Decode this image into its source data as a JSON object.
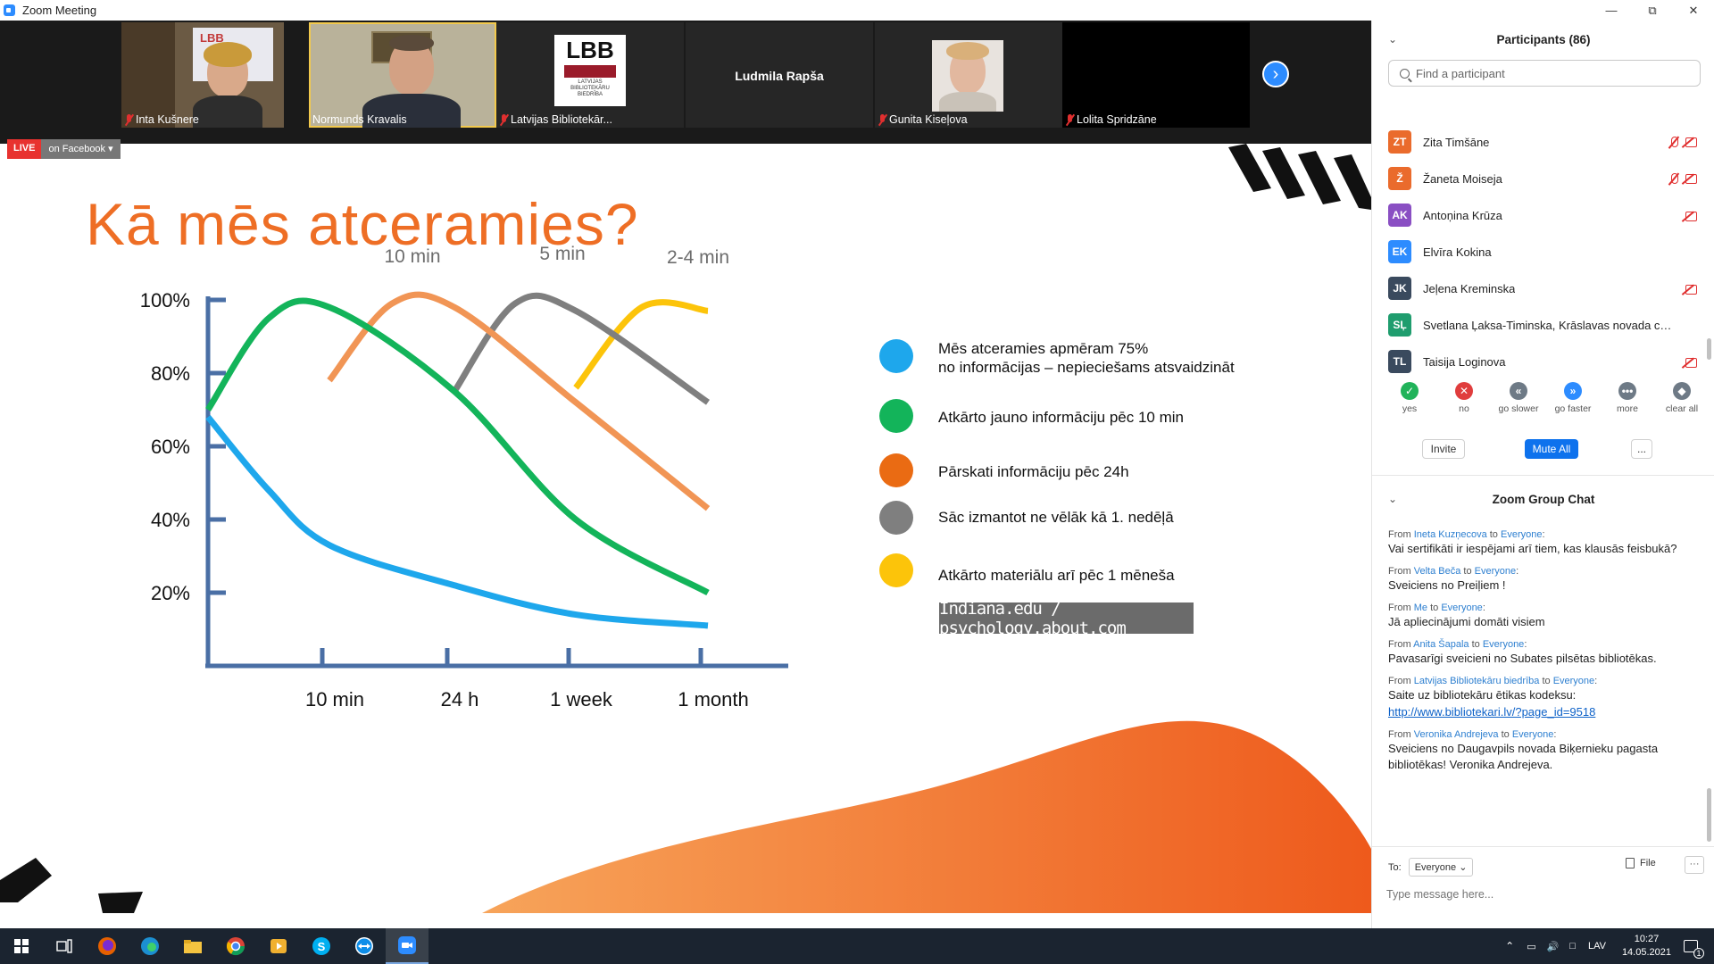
{
  "window": {
    "title": "Zoom Meeting"
  },
  "video_strip": {
    "tiles": [
      {
        "name": "Inta Kušnere",
        "muted": true
      },
      {
        "name": "Normunds Kravalis",
        "muted": false
      },
      {
        "name": "Latvijas Bibliotekār...",
        "muted": true
      },
      {
        "name": "Ludmila Rapša",
        "muted": false
      },
      {
        "name": "Gunita Kiseļova",
        "muted": true
      },
      {
        "name": "Lolita Spridzāne",
        "muted": true
      }
    ],
    "lbb_logo": {
      "big": "LBB",
      "small": "LATVIJAS BIBLIOTEKĀRU BIEDRĪBA"
    },
    "backdrop_banner": "LBB"
  },
  "live": {
    "badge": "LIVE",
    "target": "on Facebook"
  },
  "slide": {
    "title": "Kā mēs atceramies?",
    "legend": [
      {
        "color": "#1ea7ec",
        "text1": "Mēs atceramies apmēram 75%",
        "text2": "no informācijas – nepieciešams atsvaidzināt"
      },
      {
        "color": "#13b45a",
        "text1": "Atkārto jauno informāciju pēc 10 min",
        "text2": ""
      },
      {
        "color": "#ea6b13",
        "text1": "Pārskati informāciju pēc 24h",
        "text2": ""
      },
      {
        "color": "#7f7f7f",
        "text1": "Sāc izmantot ne vēlāk kā 1. nedēļā",
        "text2": ""
      },
      {
        "color": "#fcc40a",
        "text1": "Atkārto materiālu arī pēc 1 mēneša",
        "text2": ""
      }
    ],
    "source": "Indiana.edu / psychology.about.com"
  },
  "chart_data": {
    "type": "line",
    "title": "",
    "xlabel": "",
    "ylabel": "",
    "x_ticks": [
      "10 min",
      "24 h",
      "1 week",
      "1 month"
    ],
    "y_ticks": [
      "100%",
      "80%",
      "60%",
      "40%",
      "20%"
    ],
    "ylim": [
      0,
      100
    ],
    "curve_labels": [
      "10 min",
      "5 min",
      "2-4 min"
    ],
    "series": [
      {
        "color": "#1ea7ec",
        "points": [
          [
            0,
            68
          ],
          [
            0.5,
            48
          ],
          [
            1,
            33
          ],
          [
            2,
            22
          ],
          [
            3,
            14
          ],
          [
            4,
            11
          ]
        ]
      },
      {
        "color": "#13b45a",
        "points": [
          [
            0,
            70
          ],
          [
            0.5,
            95
          ],
          [
            1,
            98
          ],
          [
            2,
            75
          ],
          [
            3,
            40
          ],
          [
            4,
            20
          ]
        ]
      },
      {
        "color": "#f19555",
        "points": [
          [
            1,
            78
          ],
          [
            1.5,
            99
          ],
          [
            2,
            98
          ],
          [
            3,
            72
          ],
          [
            4,
            43
          ]
        ]
      },
      {
        "color": "#7f7f7f",
        "points": [
          [
            2,
            75
          ],
          [
            2.5,
            99
          ],
          [
            3,
            97
          ],
          [
            4,
            72
          ]
        ]
      },
      {
        "color": "#fcc40a",
        "points": [
          [
            3,
            76
          ],
          [
            3.5,
            98
          ],
          [
            4,
            97
          ]
        ]
      }
    ],
    "grid": false,
    "legend": "right"
  },
  "participants": {
    "header": "Participants (86)",
    "search_placeholder": "Find a participant",
    "list": [
      {
        "initials": "ZT",
        "name": "Zita Timšāne",
        "color": "#ea6b2c",
        "mic_off": true,
        "cam_off": true
      },
      {
        "initials": "Ž",
        "name": "Žaneta Moiseja",
        "color": "#ea6b2c",
        "mic_off": true,
        "cam_off": true
      },
      {
        "initials": "AK",
        "name": "Antoņina Krūza",
        "color": "#8a4fc3",
        "mic_off": false,
        "cam_off": true
      },
      {
        "initials": "EK",
        "name": "Elvīra Kokina",
        "color": "#2d8cff",
        "mic_off": false,
        "cam_off": false
      },
      {
        "initials": "JK",
        "name": "Jeļena Kreminska",
        "color": "#3a4a5e",
        "mic_off": false,
        "cam_off": true
      },
      {
        "initials": "SĻ",
        "name": "Svetlana Ļaksa-Timinska, Krāslavas novada centrālā...",
        "color": "#1f9d6e",
        "mic_off": false,
        "cam_off": false
      },
      {
        "initials": "TL",
        "name": "Taisija Loginova",
        "color": "#3a4a5e",
        "mic_off": false,
        "cam_off": true
      }
    ],
    "reactions": [
      {
        "label": "yes",
        "glyph": "✓",
        "color": "#21b35a"
      },
      {
        "label": "no",
        "glyph": "✕",
        "color": "#e03d3d"
      },
      {
        "label": "go slower",
        "glyph": "«",
        "color": "#6e7a86"
      },
      {
        "label": "go faster",
        "glyph": "»",
        "color": "#2d8cff"
      },
      {
        "label": "more",
        "glyph": "•••",
        "color": "#6e7a86"
      },
      {
        "label": "clear all",
        "glyph": "◆",
        "color": "#6e7a86"
      }
    ],
    "invite": "Invite",
    "mute_all": "Mute All",
    "more": "..."
  },
  "chat": {
    "header": "Zoom Group Chat",
    "messages": [
      {
        "from": "Ineta Kuzņecova",
        "to": "Everyone",
        "text": "Vai sertifikāti ir iespējami arī tiem, kas klausās feisbukā?",
        "link": false
      },
      {
        "from": "Velta Beča",
        "to": "Everyone",
        "text": "Sveiciens no Preiļiem !",
        "link": false
      },
      {
        "from": "Me",
        "to": "Everyone",
        "text": "Jā apliecinājumi domāti visiem",
        "link": false
      },
      {
        "from": "Anita Šapala",
        "to": "Everyone",
        "text": "Pavasarīgi sveicieni no Subates pilsētas bibliotēkas.",
        "link": false
      },
      {
        "from": "Latvijas Bibliotekāru biedrība",
        "to": "Everyone",
        "text": "Saite uz bibliotekāru ētikas kodeksu:",
        "link": false,
        "link_text": "http://www.bibliotekari.lv/?page_id=9518"
      },
      {
        "from": "Veronika Andrejeva",
        "to": "Everyone",
        "text": "Sveiciens no Daugavpils novada Biķernieku pagasta bibliotēkas! Veronika Andrejeva.",
        "link": false
      }
    ],
    "from_word": "From",
    "to_word": "to",
    "to_label": "To:",
    "to_value": "Everyone",
    "file_label": "File",
    "more": "···",
    "input_placeholder": "Type message here..."
  },
  "taskbar": {
    "lang": "LAV",
    "time": "10:27",
    "date": "14.05.2021",
    "notifications": "1"
  }
}
